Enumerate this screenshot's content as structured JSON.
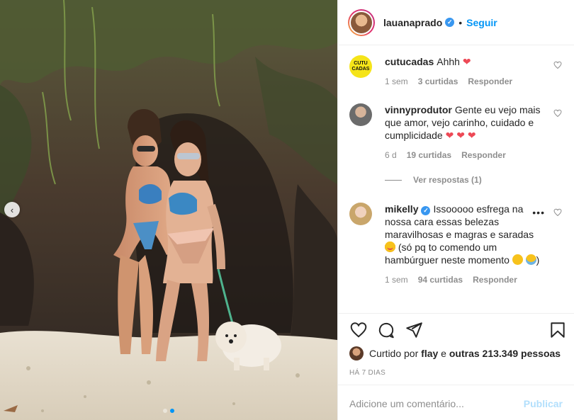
{
  "post": {
    "username": "lauanaprado",
    "verified_mark": "✓",
    "separator": "•",
    "follow_label": "Seguir",
    "nav_prev_icon": "chevron-left-icon",
    "carousel": {
      "count": 2,
      "active": 1
    }
  },
  "comments": [
    {
      "user": "cutucadas",
      "avatar_text": "CUTU\nCADAS",
      "text": "Ahhh",
      "trailing_emoji": "❤",
      "age": "1 sem",
      "likes": "3 curtidas",
      "reply": "Responder"
    },
    {
      "user": "vinnyprodutor",
      "text": "Gente eu vejo mais que amor, vejo carinho, cuidado e cumplicidade",
      "trailing_emoji": "❤ ❤ ❤",
      "age": "6 d",
      "likes": "19 curtidas",
      "reply": "Responder",
      "view_replies": "Ver respostas (1)"
    },
    {
      "user": "mikelly",
      "verified": true,
      "text": "Issooooo esfrega na nossa cara essas belezas maravilhosas e magras e saradas",
      "text_2": "(só pq to comendo um hambúrguer neste momento",
      "text_3": ")",
      "age": "1 sem",
      "likes": "94 curtidas",
      "reply": "Responder",
      "more": "•••"
    }
  ],
  "actions": {
    "liked_by_prefix": "Curtido por",
    "liked_by_user": "flay",
    "liked_by_connector": "e",
    "liked_by_count": "outras 213.349 pessoas",
    "time_ago": "HÁ 7 DIAS"
  },
  "composer": {
    "placeholder": "Adicione um comentário...",
    "publish_label": "Publicar"
  },
  "colors": {
    "accent": "#0095f6",
    "heart": "#ed4956",
    "muted": "#8e8e8e",
    "verified": "#3897f0"
  }
}
